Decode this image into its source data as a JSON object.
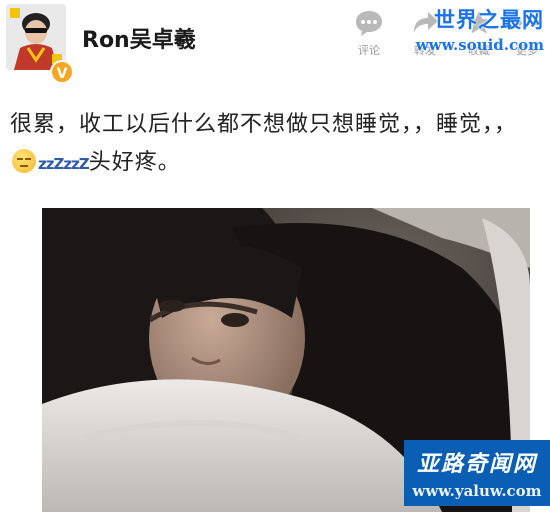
{
  "post": {
    "username": "Ron吴卓羲",
    "verified_badge": "V",
    "text_before_emoji": "很累，收工以后什么都不想做只想睡觉，，睡觉，，",
    "emoji": "sleepy-face-emoji",
    "zzz": "zzZ",
    "zzz2": "zzZ",
    "text_after_emoji": "头好疼。"
  },
  "actions": {
    "comment": "评论",
    "repost": "转发",
    "favorite": "收藏",
    "more": "更多"
  },
  "watermarks": {
    "top_title": "世界之最网",
    "top_url": "www.souid.com",
    "bottom_title": "亚路奇闻网",
    "bottom_url": "www.yaluw.com"
  },
  "colors": {
    "watermark_blue": "#1a73e8",
    "badge_orange": "#f5a623"
  }
}
